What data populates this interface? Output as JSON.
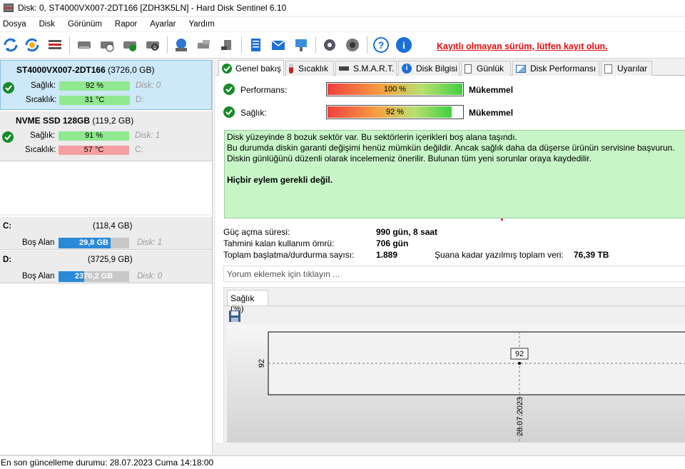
{
  "window": {
    "title": "Disk: 0, ST4000VX007-2DT166 [ZDH3K5LN]  -  Hard Disk Sentinel 6.10"
  },
  "menu": [
    "Dosya",
    "Disk",
    "Görünüm",
    "Rapor",
    "Ayarlar",
    "Yardım"
  ],
  "toolbar": {
    "register_text": "Kayıtlı olmayan sürüm, lütfen kayıt olun."
  },
  "disks": [
    {
      "name": "ST4000VX007-2DT166",
      "size": "(3726,0 GB)",
      "health_label": "Sağlık:",
      "health": "92 %",
      "health_value": 0.92,
      "temp_label": "Sıcaklık:",
      "temp": "31 °C",
      "disk_ref": "Disk: 0",
      "drive": "D:"
    },
    {
      "name": "NVME SSD 128GB",
      "size": "(119,2 GB)",
      "health_label": "Sağlık:",
      "health": "91 %",
      "health_value": 0.91,
      "temp_label": "Sıcaklık:",
      "temp": "57 °C",
      "disk_ref": "Disk: 1",
      "drive": "C:"
    }
  ],
  "volumes": [
    {
      "letter": "C:",
      "size": "(118,4 GB)",
      "free_label": "Boş Alan",
      "free": "29,8 GB",
      "used_fraction": 0.25,
      "disk_ref": "Disk: 1"
    },
    {
      "letter": "D:",
      "size": "(3725,9 GB)",
      "free_label": "Boş Alan",
      "free": "2370,2 GB",
      "used_fraction": 0.64,
      "disk_ref": "Disk: 0"
    }
  ],
  "tabs": [
    "Genel bakış",
    "Sıcaklık",
    "S.M.A.R.T.",
    "Disk Bilgisi",
    "Günlük",
    "Disk Performansı",
    "Uyarılar"
  ],
  "overview": {
    "performance_label": "Performans:",
    "performance": "100 %",
    "performance_value": 1.0,
    "performance_rating": "Mükemmel",
    "health_label": "Sağlık:",
    "health": "92 %",
    "health_value": 0.92,
    "health_rating": "Mükemmel",
    "message_lines": [
      "Disk yüzeyinde 8 bozuk sektör var. Bu sektörlerin içerikleri boş alana taşındı.",
      "Bu durumda diskin garanti değişimi henüz mümkün değildir. Ancak sağlık daha da düşerse ürünün servisine başvurun.",
      "Diskin günlüğünü düzenli olarak incelemeniz önerilir. Bulunan tüm yeni sorunlar oraya kaydedilir."
    ],
    "action": "Hiçbir eylem gerekli değil.",
    "power_on_label": "Güç açma süresi:",
    "power_on": "990 gün, 8 saat",
    "remaining_label": "Tahmini kalan kullanım ömrü:",
    "remaining": "706 gün",
    "startstop_label": "Toplam başlatma/durdurma sayısı:",
    "startstop": "1.889",
    "written_label": "Şuana kadar yazılmış toplam veri:",
    "written": "76,39 TB",
    "comment_placeholder": "Yorum eklemek için tıklayın ..."
  },
  "chart_tab": "Sağlık (%)",
  "chart_data": {
    "type": "line",
    "x": [
      "28.07.2023"
    ],
    "series": [
      {
        "values": [
          92
        ]
      }
    ],
    "data_labels": [
      "92"
    ],
    "ytick": "92"
  },
  "status": "En son güncelleme durumu: 28.07.2023 Cuma 14:18:00",
  "colors": {
    "accent_red": "#e01010",
    "health_green": "#90e890",
    "temp_red": "#f4a0a0",
    "message_bg": "#c7f5c7",
    "free_blue": "#2a8ad8"
  }
}
